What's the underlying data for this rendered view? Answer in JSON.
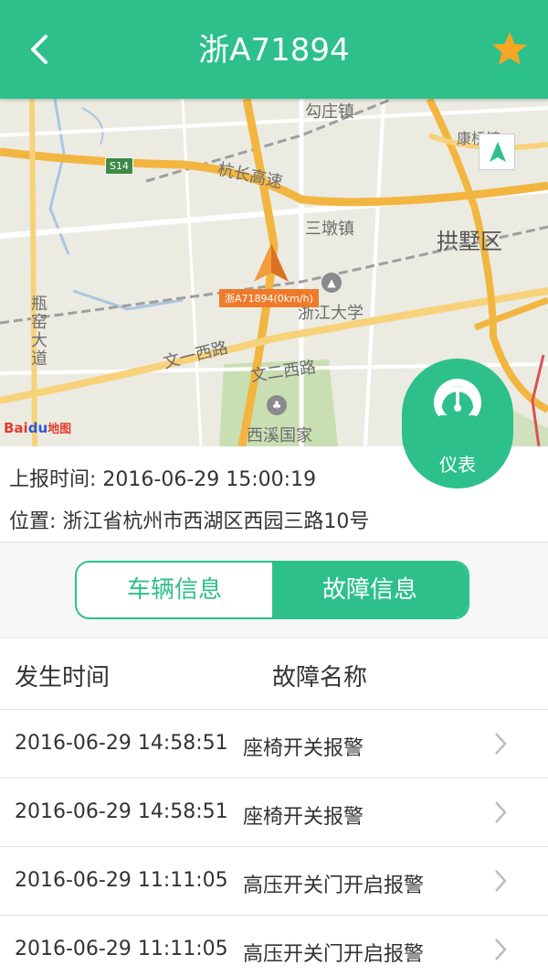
{
  "header": {
    "title": "浙A71894",
    "back_icon": "chevron-left-icon",
    "favorite_icon": "star-icon",
    "color": "#2dc08a",
    "star_color": "#f5a623"
  },
  "map": {
    "labels": {
      "s14": "S14",
      "hangchang": "杭长高速",
      "sandun": "三墩镇",
      "gongshu": "拱墅区",
      "zheda": "浙江大学",
      "wenyi": "文一西路",
      "wener": "文二西路",
      "xixi": "西溪国家",
      "goutu": "勾庄镇",
      "kangqiao": "康桥镇",
      "pingyao": "瓶窑大道"
    },
    "vehicle_tag": "浙A71894(0km/h)",
    "logo_text": "Bai",
    "logo_paw": "du",
    "logo_ditu": "地图",
    "compass_icon": "navigation-arrow-icon"
  },
  "dashboard": {
    "label": "仪表",
    "icon": "gauge-icon"
  },
  "info": {
    "report_time_label": "上报时间:",
    "report_time": "2016-06-29 15:00:19",
    "location_label": "位置:",
    "location": "浙江省杭州市西湖区西园三路10号"
  },
  "tabs": [
    {
      "label": "车辆信息",
      "active": false
    },
    {
      "label": "故障信息",
      "active": true
    }
  ],
  "list": {
    "col_time": "发生时间",
    "col_name": "故障名称",
    "rows": [
      {
        "time": "2016-06-29 14:58:51",
        "name": "座椅开关报警"
      },
      {
        "time": "2016-06-29 14:58:51",
        "name": "座椅开关报警"
      },
      {
        "time": "2016-06-29 11:11:05",
        "name": "高压开关门开启报警"
      },
      {
        "time": "2016-06-29 11:11:05",
        "name": "高压开关门开启报警"
      }
    ]
  }
}
